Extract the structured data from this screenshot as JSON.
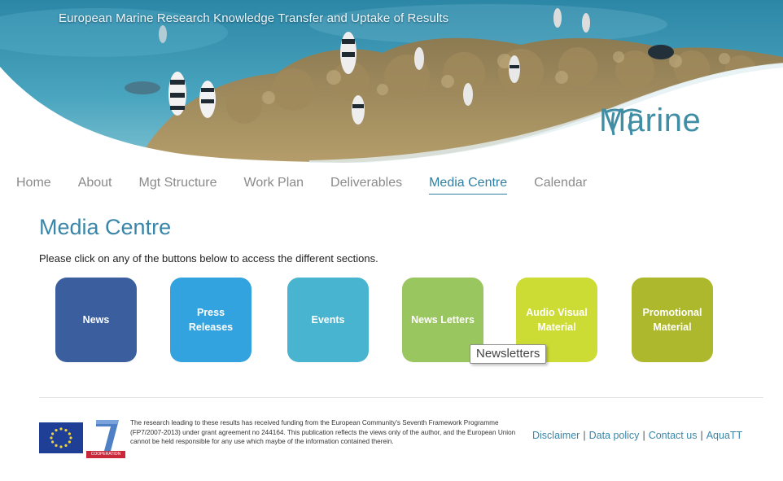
{
  "banner": {
    "title": "European Marine Research Knowledge Transfer and Uptake of Results",
    "logo_text": "Marine"
  },
  "nav": {
    "items": [
      {
        "label": "Home",
        "active": false
      },
      {
        "label": "About",
        "active": false
      },
      {
        "label": "Mgt Structure",
        "active": false
      },
      {
        "label": "Work Plan",
        "active": false
      },
      {
        "label": "Deliverables",
        "active": false
      },
      {
        "label": "Media Centre",
        "active": true
      },
      {
        "label": "Calendar",
        "active": false
      }
    ]
  },
  "main": {
    "title": "Media Centre",
    "intro": "Please click on any of the buttons below to access the different sections."
  },
  "buttons": [
    {
      "label": "News",
      "color": "#3a5e9e"
    },
    {
      "label": "Press\nReleases",
      "color": "#33a3df"
    },
    {
      "label": "Events",
      "color": "#49b4cf"
    },
    {
      "label": "News Letters",
      "color": "#99c65f"
    },
    {
      "label": "Audio Visual\nMaterial",
      "color": "#cddb35"
    },
    {
      "label": "Promotional\nMaterial",
      "color": "#adb82d"
    }
  ],
  "tooltip": {
    "text": "Newsletters"
  },
  "footer": {
    "fp7_caption": "COOPERATION",
    "disclaimer": "The research leading to these results has received funding from the European Community's Seventh Framework Programme (FP7/2007-2013) under grant agreement no 244164. This publication reflects the views only of the author, and the European Union cannot be held responsible for any use which maybe of the information contained therein.",
    "links": [
      "Disclaimer",
      "Data policy",
      "Contact us",
      "AquaTT"
    ]
  }
}
